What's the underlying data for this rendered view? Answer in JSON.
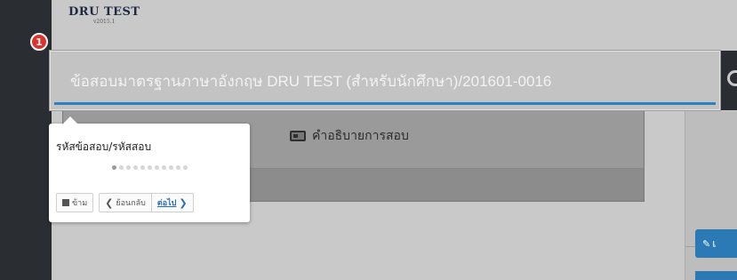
{
  "brand": {
    "name": "DRU TEST",
    "version": "v2015.1"
  },
  "tour": {
    "step_number": "1",
    "highlight_title": "ข้อสอบมาตรฐานภาษาอังกฤษ DRU TEST (สำหรับนักศึกษา)/201601-0016",
    "popover": {
      "title": "รหัสข้อสอบ/รหัสสอบ",
      "progress": {
        "current": 1,
        "total": 11
      },
      "skip_label": "ข้าม",
      "prev_label": "ย้อนกลับ",
      "next_label": "ต่อไป"
    }
  },
  "page": {
    "exam_description_label": "คำอธิบายการสอบ",
    "edit_button_label": "เ"
  },
  "colors": {
    "accent": "#2f80c2",
    "marker": "#e0322c",
    "button_blue": "#2b79b5"
  },
  "icons": {
    "skip": "stop-icon",
    "prev": "chevron-left-icon",
    "next": "chevron-right-icon",
    "description": "id-card-icon",
    "edit": "pencil-icon"
  }
}
